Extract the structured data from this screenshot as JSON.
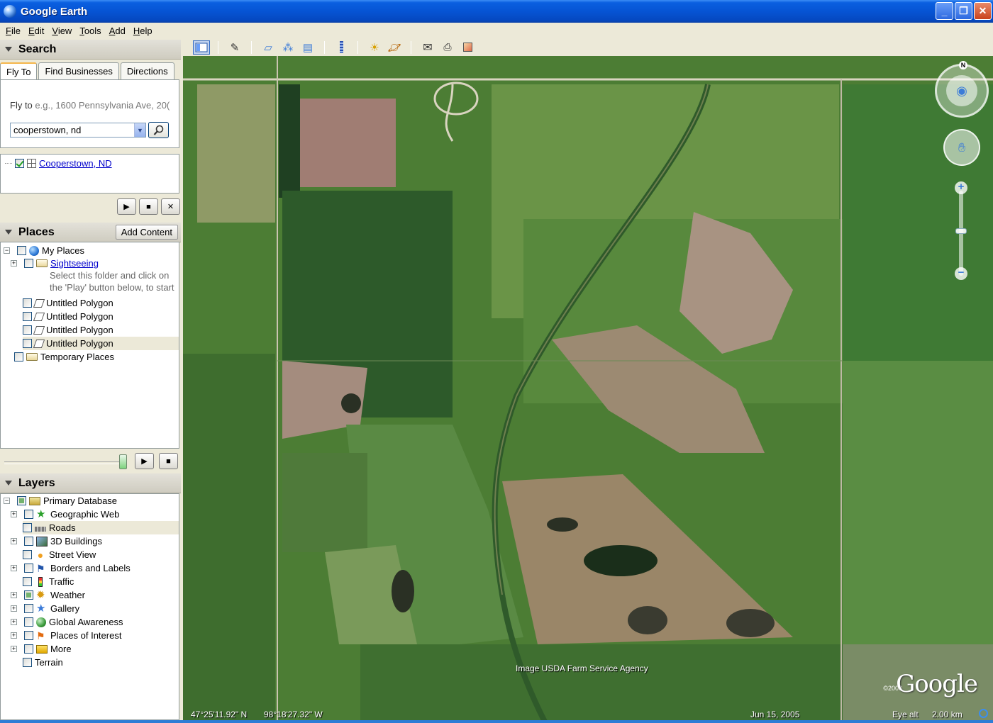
{
  "window": {
    "title": "Google Earth",
    "buttons": {
      "minimize": "_",
      "maximize": "❐",
      "close": "✕"
    }
  },
  "menu": [
    {
      "u": "F",
      "rest": "ile"
    },
    {
      "u": "E",
      "rest": "dit"
    },
    {
      "u": "V",
      "rest": "iew"
    },
    {
      "u": "T",
      "rest": "ools"
    },
    {
      "u": "A",
      "rest": "dd"
    },
    {
      "u": "H",
      "rest": "elp"
    }
  ],
  "search": {
    "header": "Search",
    "tabs": [
      "Fly To",
      "Find Businesses",
      "Directions"
    ],
    "flyto_label": "Fly to",
    "flyto_placeholder": "e.g., 1600 Pennsylvania Ave, 20(",
    "input_value": "cooperstown, nd",
    "result": "Cooperstown, ND"
  },
  "places": {
    "header": "Places",
    "add_content": "Add Content",
    "items": {
      "my_places": "My Places",
      "sightseeing": "Sightseeing",
      "sightseeing_note_1": "Select this folder and click on",
      "sightseeing_note_2": "the 'Play' button below, to start",
      "polygon_1": "Untitled Polygon",
      "polygon_2": "Untitled Polygon",
      "polygon_3": "Untitled Polygon",
      "polygon_4": "Untitled Polygon",
      "temporary": "Temporary Places"
    },
    "tour_slider_fraction": 1.0
  },
  "layers": {
    "header": "Layers",
    "items": {
      "primary": "Primary Database",
      "geographic_web": "Geographic Web",
      "roads": "Roads",
      "buildings": "3D Buildings",
      "street_view": "Street View",
      "borders": "Borders and Labels",
      "traffic": "Traffic",
      "weather": "Weather",
      "gallery": "Gallery",
      "global_awareness": "Global Awareness",
      "poi": "Places of Interest",
      "more": "More",
      "terrain": "Terrain"
    }
  },
  "map": {
    "attribution": "Image USDA Farm Service Agency",
    "logo": "Google",
    "copyright": "©2008",
    "lat": "47°25'11.92\" N",
    "lon": "98°18'27.32\" W",
    "date": "Jun 15, 2005",
    "eye_alt_label": "Eye alt",
    "eye_alt_value": "2.00 km",
    "compass_n": "N",
    "zoom_plus": "+",
    "zoom_minus": "−"
  },
  "colors": {
    "title_blue": "#0654d4",
    "accent_orange": "#f5b64b",
    "link": "#0000cc"
  }
}
